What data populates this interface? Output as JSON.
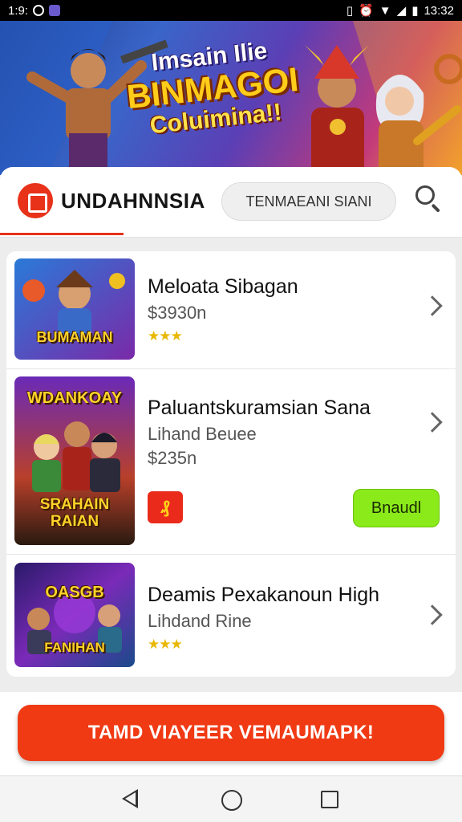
{
  "status_bar": {
    "time": "1:9:",
    "right_time": "13:32",
    "icons": [
      "app-icon",
      "notification-icon",
      "sim-icon",
      "alarm-icon",
      "wifi-icon",
      "signal-icon",
      "battery-icon"
    ]
  },
  "banner": {
    "line1": "Imsain Ilie",
    "line2": "BINMAGOI",
    "line3": "Coluimina!!"
  },
  "header": {
    "brand_name": "UNDAHNNSIA",
    "tab_label": "TENMAEANI SIANI",
    "search_icon": "search-icon",
    "accent": "#e8321a"
  },
  "games": [
    {
      "title": "Meloata Sibagan",
      "price": "$3930n",
      "stars": "★★★",
      "thumb_text": "BUMAMAN"
    },
    {
      "title": "Paluantskuramsian Sana",
      "subtitle": "Lihand Beuee",
      "price": "$235n",
      "thumb_text_top": "WDANKOAY",
      "thumb_text_bottom": "SRAHAIN RAIAN",
      "badge": "₰",
      "button_label": "Bnaudl"
    },
    {
      "title": "Deamis Pexakanoun High",
      "subtitle": "Lihdand Rine",
      "stars": "★★★",
      "thumb_text_top": "OASGB",
      "thumb_text_bottom": "FANIHAN"
    }
  ],
  "cta": {
    "label": "TAMD VIAYEER VEMAUMAPK!",
    "color": "#f03a14"
  },
  "navbar": {
    "icons": [
      "back-icon",
      "home-icon",
      "recents-icon"
    ]
  }
}
